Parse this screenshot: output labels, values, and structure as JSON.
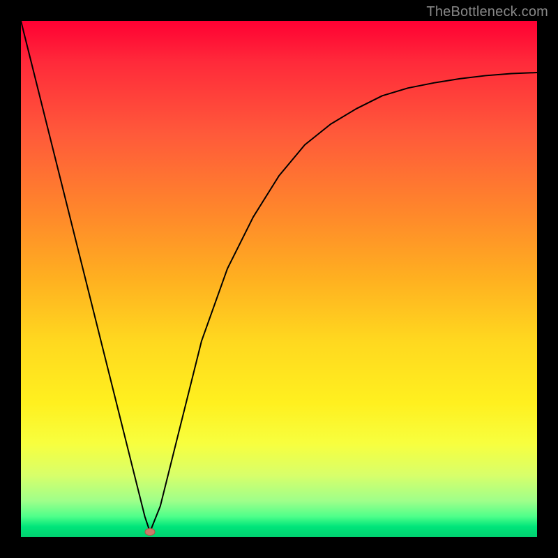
{
  "watermark": "TheBottleneck.com",
  "chart_data": {
    "type": "line",
    "title": "",
    "xlabel": "",
    "ylabel": "",
    "xlim": [
      0,
      100
    ],
    "ylim": [
      0,
      100
    ],
    "grid": false,
    "legend": false,
    "series": [
      {
        "name": "bottleneck-curve",
        "x": [
          0,
          5,
          10,
          15,
          18,
          20,
          22,
          24,
          25,
          27,
          30,
          35,
          40,
          45,
          50,
          55,
          60,
          65,
          70,
          75,
          80,
          85,
          90,
          95,
          100
        ],
        "values": [
          100,
          80,
          60,
          40,
          28,
          20,
          12,
          4,
          1,
          6,
          18,
          38,
          52,
          62,
          70,
          76,
          80,
          83,
          85.5,
          87,
          88,
          88.8,
          89.4,
          89.8,
          90
        ]
      }
    ],
    "marker": {
      "x": 25,
      "y": 1
    },
    "colors": {
      "curve": "#000000",
      "marker_fill": "#cc7a6a",
      "marker_stroke": "#a85a4a",
      "gradient_top": "#ff0033",
      "gradient_bottom": "#00d070"
    }
  }
}
